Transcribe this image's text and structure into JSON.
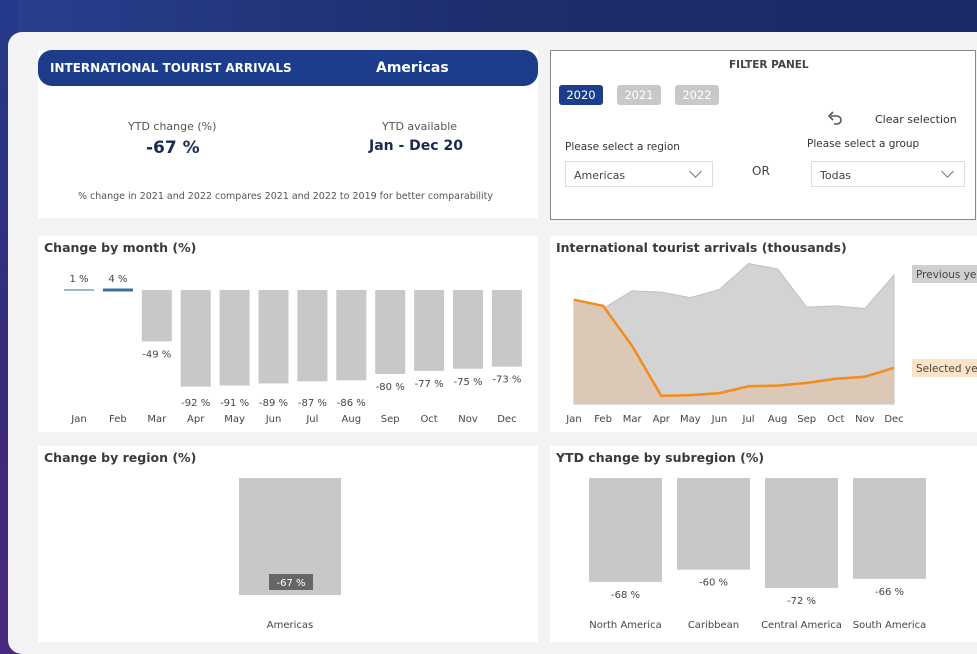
{
  "header": {
    "title": "INTERNATIONAL TOURIST ARRIVALS",
    "region": "Americas",
    "ytd_change_label": "YTD change (%)",
    "ytd_change_value": "-67 %",
    "ytd_available_label": "YTD available",
    "ytd_available_value": "Jan - Dec 20",
    "note": "% change in 2021 and 2022 compares 2021 and 2022  to 2019 for better comparability"
  },
  "filter": {
    "title": "FILTER PANEL",
    "years": [
      "2020",
      "2021",
      "2022"
    ],
    "active_year": "2020",
    "clear_label": "Clear selection",
    "region_label": "Please select a region",
    "region_value": "Americas",
    "or_label": "OR",
    "group_label": "Please select a group",
    "group_value": "Todas"
  },
  "colors": {
    "accent": "#1c3d8c",
    "bar_gray": "#c8c8c8",
    "area_gray": "#d3d3d3",
    "selected_orange": "#f28c1c",
    "selected_fill": "#dcc7b4",
    "label_bg_dark": "#666666",
    "prev_label_bg": "#cfcfcf",
    "sel_label_bg": "#fde3c8"
  },
  "chart_data": [
    {
      "type": "bar",
      "title": "Change by month (%)",
      "categories": [
        "Jan",
        "Feb",
        "Mar",
        "Apr",
        "May",
        "Jun",
        "Jul",
        "Aug",
        "Sep",
        "Oct",
        "Nov",
        "Dec"
      ],
      "values": [
        1,
        4,
        -49,
        -92,
        -91,
        -89,
        -87,
        -86,
        -80,
        -77,
        -75,
        -73
      ],
      "labels": [
        "1 %",
        "4 %",
        "-49 %",
        "-92 %",
        "-91 %",
        "-89 %",
        "-87 %",
        "-86 %",
        "-80 %",
        "-77 %",
        "-75 %",
        "-73 %"
      ],
      "ylim": [
        -100,
        5
      ]
    },
    {
      "type": "area",
      "title": "International tourist arrivals (thousands)",
      "categories": [
        "Jan",
        "Feb",
        "Mar",
        "Apr",
        "May",
        "Jun",
        "Jul",
        "Aug",
        "Sep",
        "Oct",
        "Nov",
        "Dec"
      ],
      "series": [
        {
          "name": "Previous year",
          "values": [
            15.2,
            14.0,
            16.6,
            16.4,
            15.6,
            16.8,
            20.6,
            19.8,
            14.2,
            14.4,
            14.0,
            18.9
          ]
        },
        {
          "name": "Selected year",
          "values": [
            15.3,
            14.4,
            8.5,
            1.2,
            1.3,
            1.6,
            2.6,
            2.7,
            3.1,
            3.7,
            4.0,
            5.3
          ]
        }
      ],
      "grid": false
    },
    {
      "type": "bar",
      "title": "Change by region (%)",
      "categories": [
        "Americas"
      ],
      "values": [
        -67
      ],
      "labels": [
        "-67 %"
      ],
      "ylim": [
        -67,
        0
      ]
    },
    {
      "type": "bar",
      "title": "YTD change by subregion (%)",
      "categories": [
        "North America",
        "Caribbean",
        "Central America",
        "South America"
      ],
      "values": [
        -68,
        -60,
        -72,
        -66
      ],
      "labels": [
        "-68 %",
        "-60 %",
        "-72 %",
        "-66 %"
      ],
      "ylim": [
        -72,
        0
      ]
    }
  ]
}
